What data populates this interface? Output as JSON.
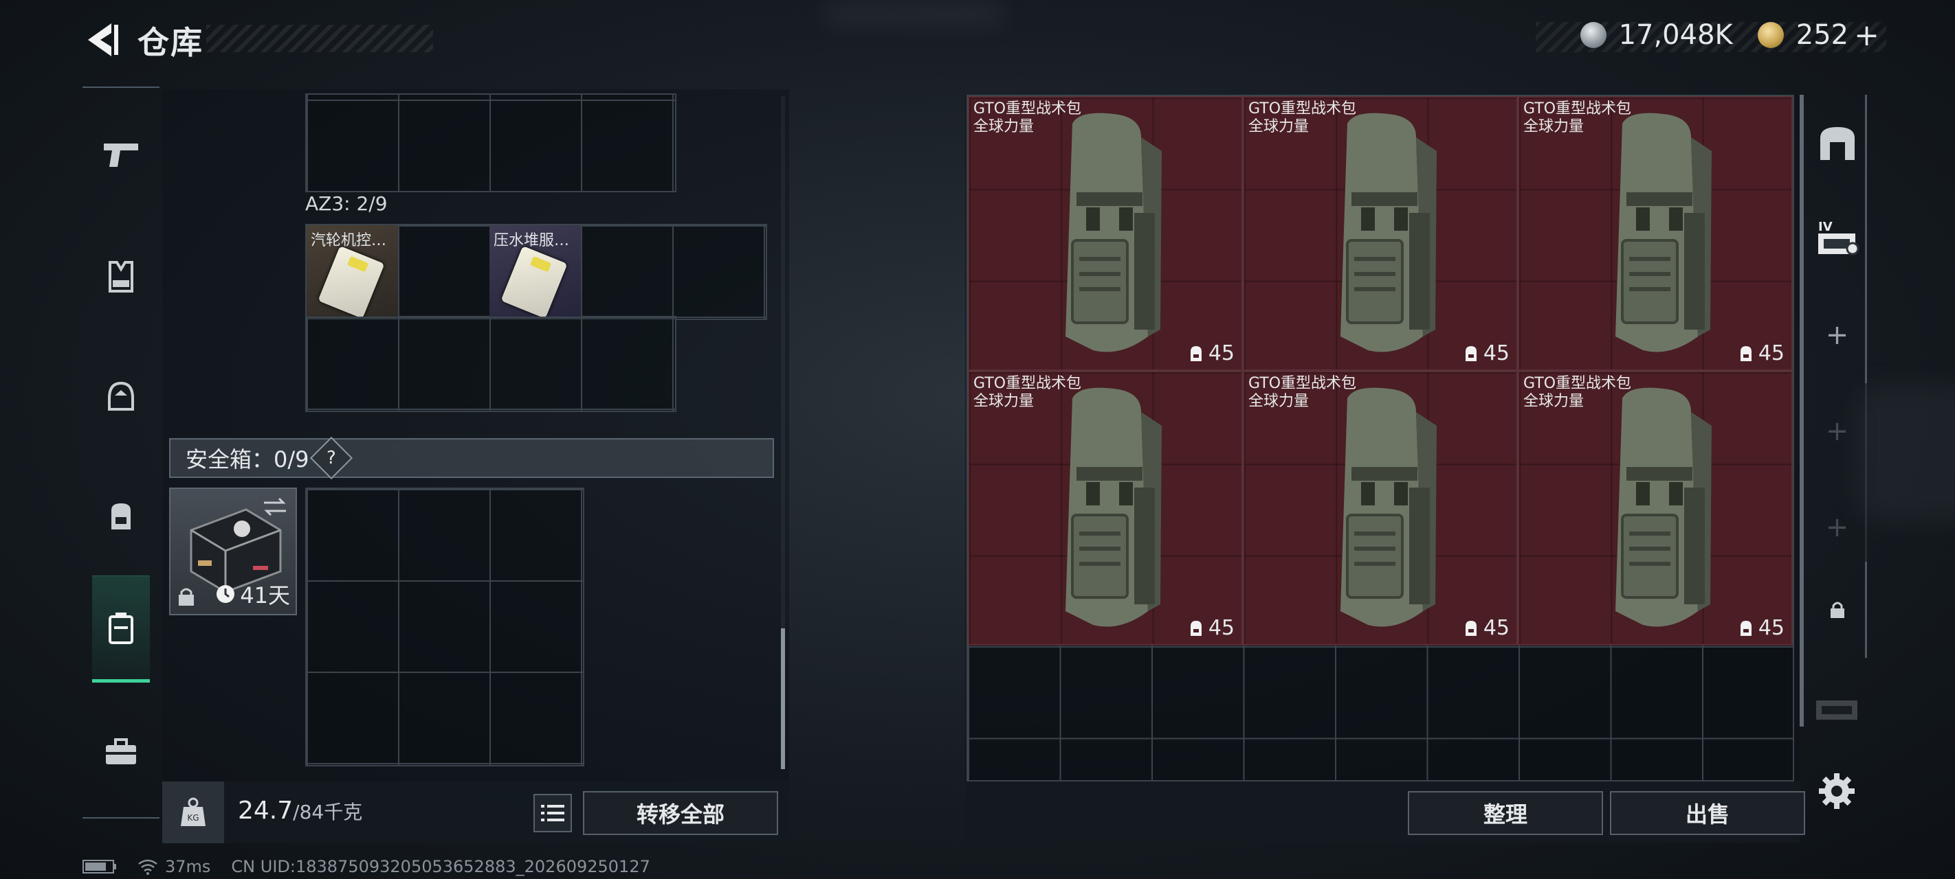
{
  "header": {
    "title": "仓库"
  },
  "currency": {
    "silver": {
      "icon": "silver-coin-icon",
      "value": "17,048K"
    },
    "gold": {
      "icon": "gold-coin-icon",
      "value": "252",
      "add_label": "+"
    }
  },
  "left_sidebar": {
    "items": [
      {
        "name": "weapons",
        "icon": "pistol-icon",
        "active": false
      },
      {
        "name": "armor",
        "icon": "vest-icon",
        "active": false
      },
      {
        "name": "helmet",
        "icon": "helmet-icon",
        "active": false
      },
      {
        "name": "backpack",
        "icon": "backpack-icon",
        "active": false
      },
      {
        "name": "container",
        "icon": "container-icon",
        "active": true
      },
      {
        "name": "toolkit",
        "icon": "toolkit-icon",
        "active": false
      }
    ]
  },
  "left_panel": {
    "az3_label": "AZ3: 2/9",
    "az3_items": [
      {
        "label": "汽轮机控…"
      },
      {
        "label": "压水堆服…"
      }
    ],
    "safe": {
      "header": "安全箱：0/9",
      "help_label": "?",
      "duration": "41天"
    },
    "weight": {
      "current": "24.7",
      "max": "/84千克"
    },
    "transfer_all_label": "转移全部"
  },
  "right_panel": {
    "backpacks": [
      {
        "name": "GTO重型战术包",
        "sub": "全球力量",
        "capacity": "45"
      },
      {
        "name": "GTO重型战术包",
        "sub": "全球力量",
        "capacity": "45"
      },
      {
        "name": "GTO重型战术包",
        "sub": "全球力量",
        "capacity": "45"
      },
      {
        "name": "GTO重型战术包",
        "sub": "全球力量",
        "capacity": "45"
      },
      {
        "name": "GTO重型战术包",
        "sub": "全球力量",
        "capacity": "45"
      },
      {
        "name": "GTO重型战术包",
        "sub": "全球力量",
        "capacity": "45"
      }
    ],
    "sort_label": "整理",
    "sell_label": "出售"
  },
  "right_sidebar": {
    "tab_label": "IV",
    "add_label": "+"
  },
  "status_bar": {
    "ping": "37ms",
    "uid": "CN UID:18387509320505365​2883_202609250127"
  },
  "colors": {
    "accent": "#3fd39a",
    "item_bg_red": "#4a1e24"
  }
}
